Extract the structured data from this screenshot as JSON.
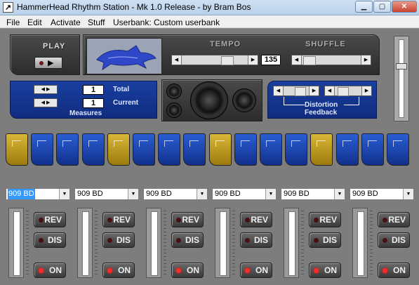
{
  "window": {
    "title": "HammerHead Rhythm Station - Mk 1.0 Release - by Bram Bos",
    "icon": "hammerhead-app-icon",
    "controls": [
      "minimize-icon",
      "maximize-icon",
      "close-icon"
    ]
  },
  "menu": {
    "items": [
      "File",
      "Edit",
      "Activate",
      "Stuff"
    ],
    "userbank_label": "Userbank: Custom userbank"
  },
  "transport": {
    "play_label": "PLAY",
    "play_icon": "play-icon"
  },
  "tempo": {
    "label": "TEMPO",
    "value": "135"
  },
  "shuffle": {
    "label": "SHUFFLE"
  },
  "measures": {
    "total_value": "1",
    "total_label": "Total",
    "current_value": "1",
    "current_label": "Current",
    "label": "Measures"
  },
  "effects": {
    "distortion_label": "Distortion",
    "feedback_label": "Feedback"
  },
  "pads": [
    "gold",
    "blue",
    "blue",
    "blue",
    "gold",
    "blue",
    "blue",
    "blue",
    "gold",
    "blue",
    "blue",
    "blue",
    "gold",
    "blue",
    "blue",
    "blue"
  ],
  "channels": [
    {
      "sample": "909 BD",
      "rev": "REV",
      "dis": "DIS",
      "on": "ON"
    },
    {
      "sample": "909 BD",
      "rev": "REV",
      "dis": "DIS",
      "on": "ON"
    },
    {
      "sample": "909 BD",
      "rev": "REV",
      "dis": "DIS",
      "on": "ON"
    },
    {
      "sample": "909 BD",
      "rev": "REV",
      "dis": "DIS",
      "on": "ON"
    },
    {
      "sample": "909 BD",
      "rev": "REV",
      "dis": "DIS",
      "on": "ON"
    },
    {
      "sample": "909 BD",
      "rev": "REV",
      "dis": "DIS",
      "on": "ON"
    }
  ],
  "colors": {
    "gold_pad": "#c7a22a",
    "blue_pad": "#1f4fc0",
    "panel_blue": "#1a3fa0",
    "led_on": "#ff2a2a"
  }
}
